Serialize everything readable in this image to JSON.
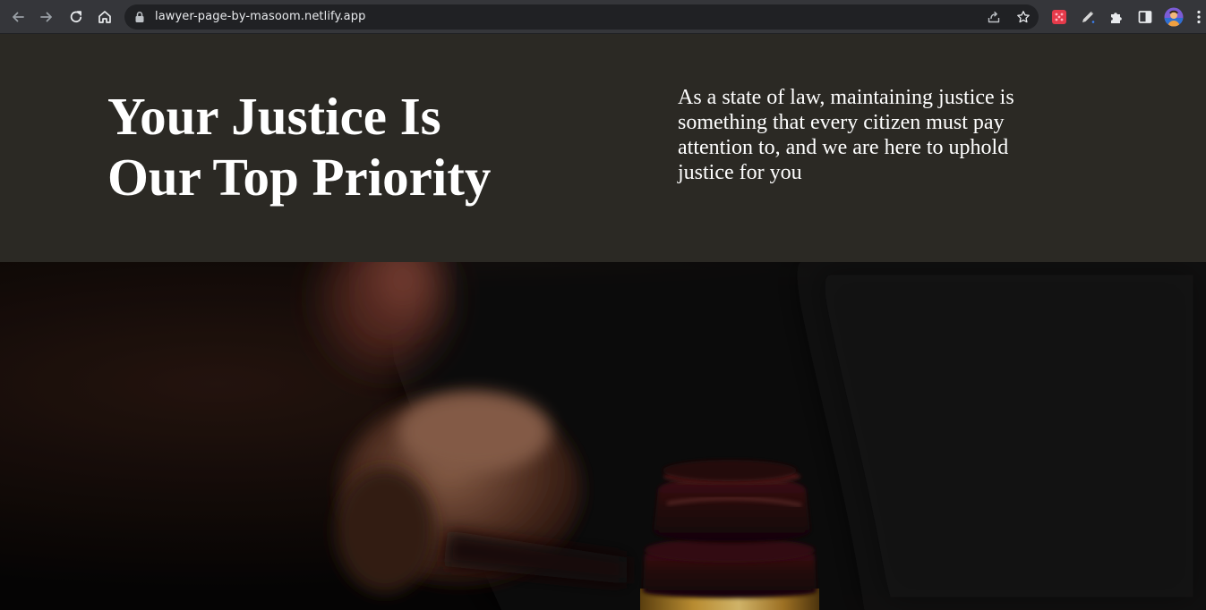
{
  "browser": {
    "url": "lawyer-page-by-masoom.netlify.app",
    "icons": {
      "back": "arrow-left-icon",
      "forward": "arrow-right-icon",
      "reload": "reload-icon",
      "home": "home-icon",
      "lock": "lock-icon",
      "share": "share-icon",
      "bookmark": "star-icon",
      "extension_1": "red-extension-icon",
      "extension_2": "pencil-extension-icon",
      "extensions": "puzzle-icon",
      "side_panel": "side-panel-icon",
      "profile": "profile-avatar",
      "menu": "kebab-menu-icon"
    }
  },
  "hero": {
    "title": "Your Justice Is\nOur Top Priority",
    "description": "As a state of law, maintaining justice is something that every citizen must pay attention to, and we are here to uphold justice for you",
    "background_color": "#2b2924",
    "text_color": "#ffffff"
  },
  "photo": {
    "subject": "gavel-photo"
  }
}
